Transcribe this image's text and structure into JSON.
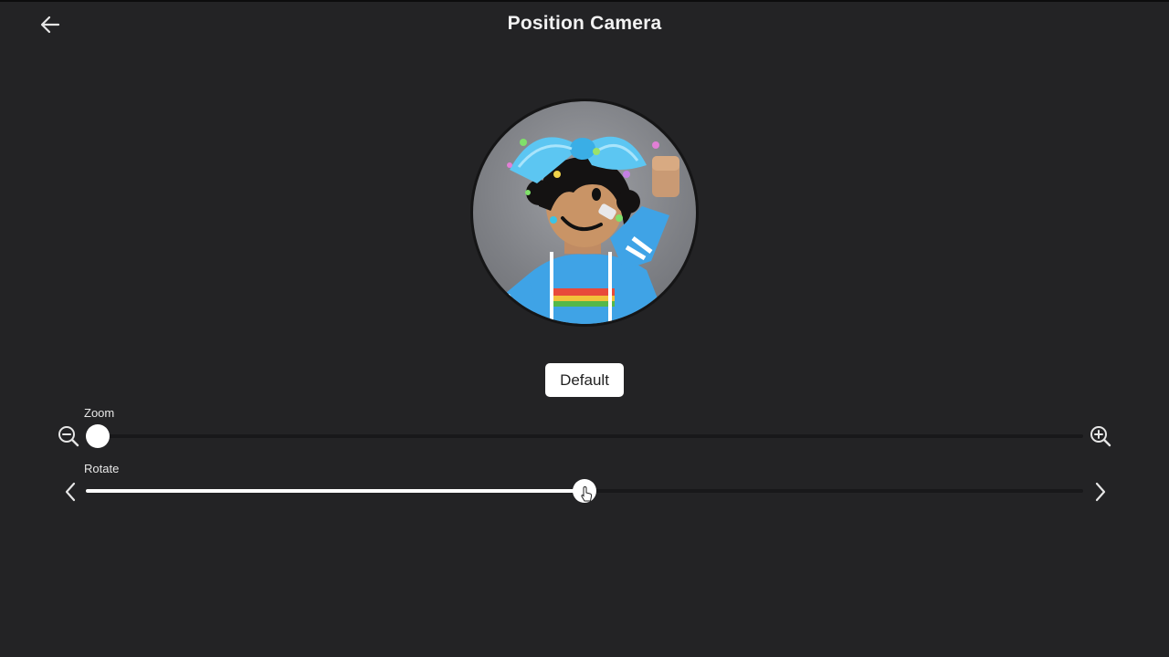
{
  "header": {
    "title": "Position Camera",
    "back_icon": "arrow-left-icon"
  },
  "preview": {
    "description_icon": "avatar-headshot"
  },
  "actions": {
    "default_label": "Default"
  },
  "zoom": {
    "label": "Zoom",
    "value_fraction": 0.01,
    "min_icon": "zoom-out-icon",
    "max_icon": "zoom-in-icon"
  },
  "rotate": {
    "label": "Rotate",
    "value_fraction": 0.5,
    "left_icon": "chevron-left-icon",
    "right_icon": "chevron-right-icon"
  },
  "colors": {
    "background": "#232325",
    "track": "#18181a",
    "fill": "#ffffff",
    "text": "#f2f2f2"
  }
}
